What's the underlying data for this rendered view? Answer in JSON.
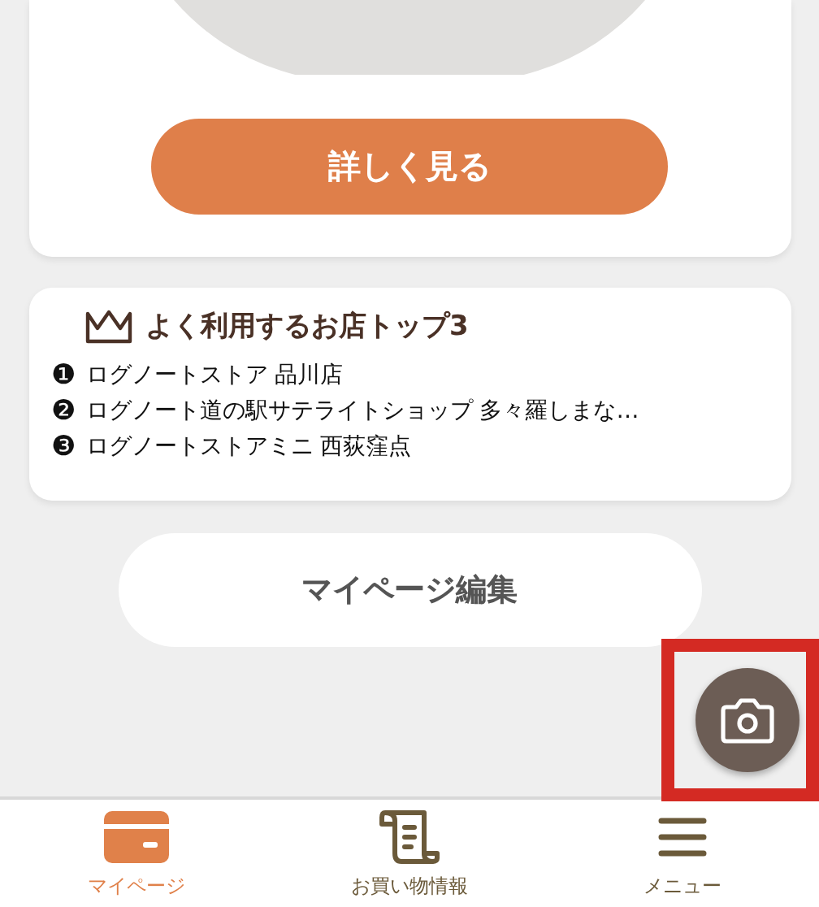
{
  "detail_button": "詳しく見る",
  "top_stores": {
    "title": "よく利用するお店トップ3",
    "items": [
      {
        "rank": "❶",
        "name": "ログノートストア 品川店"
      },
      {
        "rank": "❷",
        "name": "ログノート道の駅サテライトショップ 多々羅しまな…"
      },
      {
        "rank": "❸",
        "name": "ログノートストアミニ 西荻窪点"
      }
    ]
  },
  "edit_button": "マイページ編集",
  "nav": [
    {
      "kind": "card",
      "label": "マイページ",
      "selected": true
    },
    {
      "kind": "receipt",
      "label": "お買い物情報",
      "selected": false
    },
    {
      "kind": "menu",
      "label": "メニュー",
      "selected": false
    }
  ]
}
